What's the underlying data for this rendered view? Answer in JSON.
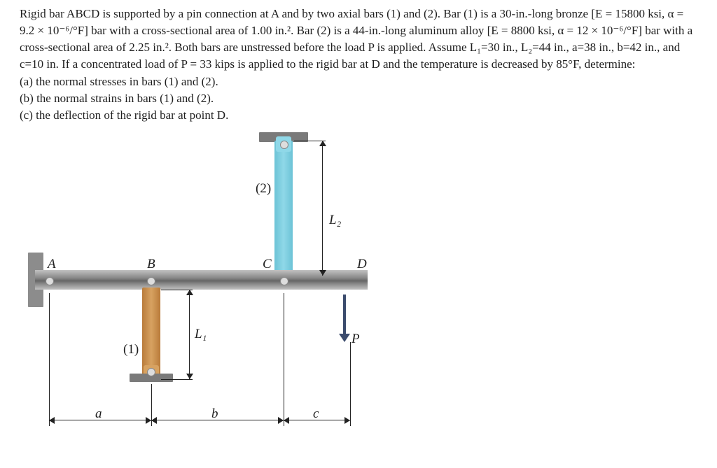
{
  "problem": {
    "text": "Rigid bar ABCD is supported by a pin connection at A and by two axial bars (1) and (2). Bar (1) is a 30-in.-long bronze [E = 15800 ksi, α =   9.2 × 10⁻⁶/°F] bar with a cross-sectional area of 1.00 in.². Bar (2) is a 44-in.-long aluminum alloy [E = 8800 ksi, α =   12 × 10⁻⁶/°F] bar with a cross-sectional area of 2.25 in.². Both bars are unstressed before the load P is applied. Assume L₁=30 in., L₂=44 in., a=38 in., b=42 in., and c=10 in. If a concentrated load of P = 33 kips is applied to the rigid bar at D and the temperature is decreased by 85°F, determine:",
    "part_a": "(a) the normal stresses in bars (1) and (2).",
    "part_b": "(b) the normal strains in bars (1) and (2).",
    "part_c": "(c) the deflection of the rigid bar at point D."
  },
  "diagram_labels": {
    "A": "A",
    "B": "B",
    "C": "C",
    "D": "D",
    "P": "P",
    "bar1": "(1)",
    "bar2": "(2)",
    "L1": "L₁",
    "L2": "L₂",
    "a": "a",
    "b": "b",
    "c": "c"
  }
}
